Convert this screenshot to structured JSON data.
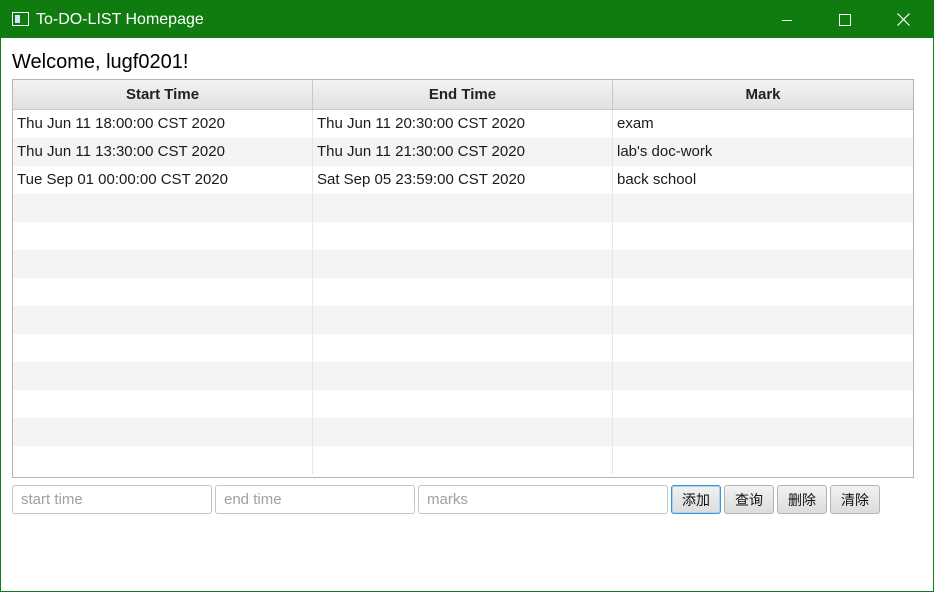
{
  "window": {
    "title": "To-DO-LIST Homepage",
    "accent_color": "#107c10",
    "controls": {
      "minimize_icon": "minimize-icon",
      "maximize_icon": "maximize-icon",
      "close_icon": "close-icon"
    }
  },
  "welcome": "Welcome, lugf0201!",
  "table": {
    "columns": [
      "Start Time",
      "End Time",
      "Mark"
    ],
    "rows": [
      [
        "Thu Jun 11 18:00:00 CST 2020",
        "Thu Jun 11 20:30:00 CST 2020",
        "exam"
      ],
      [
        "Thu Jun 11 13:30:00 CST 2020",
        "Thu Jun 11 21:30:00 CST 2020",
        "lab's doc-work"
      ],
      [
        "Tue Sep 01 00:00:00 CST 2020",
        "Sat Sep 05 23:59:00 CST 2020",
        "back school"
      ]
    ],
    "empty_row_count": 10
  },
  "form": {
    "start_placeholder": "start time",
    "end_placeholder": "end time",
    "marks_placeholder": "marks",
    "start_value": "",
    "end_value": "",
    "marks_value": ""
  },
  "buttons": {
    "add": "添加",
    "query": "查询",
    "delete": "删除",
    "clear": "清除"
  }
}
